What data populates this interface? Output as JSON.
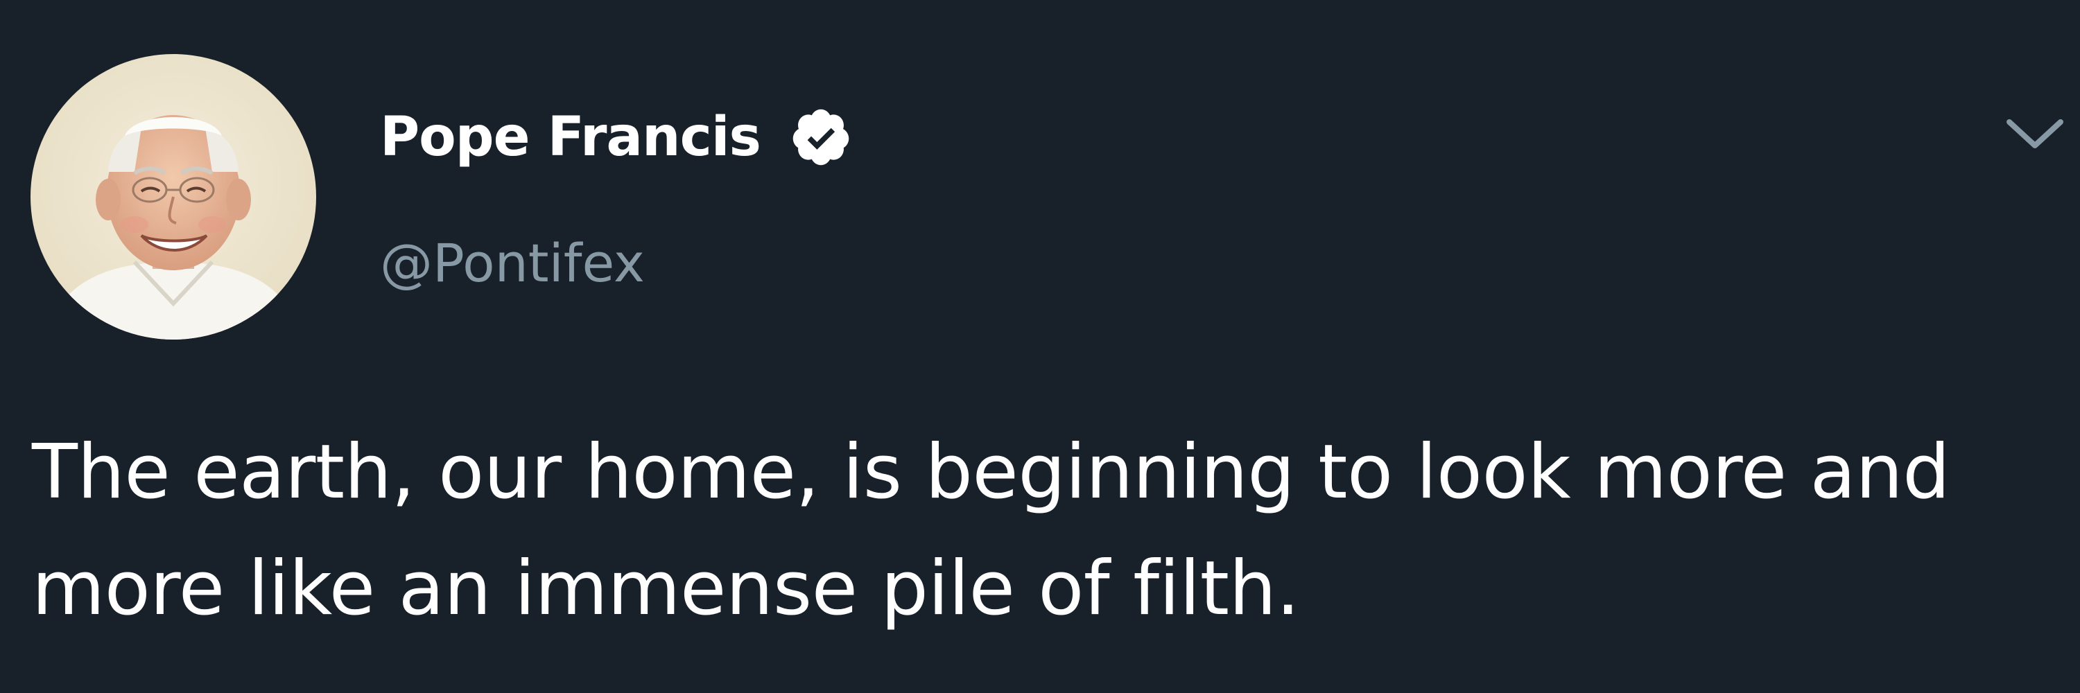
{
  "tweet": {
    "display_name": "Pope Francis",
    "handle": "@Pontifex",
    "verified": true,
    "text": "The earth, our home, is beginning to look more and more like an immense pile of filth."
  },
  "icons": {
    "avatar": "profile-photo",
    "badge": "verified-badge-icon",
    "menu": "chevron-down-icon"
  },
  "colors": {
    "background": "#18202a",
    "name": "#ffffff",
    "handle": "#8899a6",
    "text": "#ffffff",
    "caret": "#8899a6"
  }
}
